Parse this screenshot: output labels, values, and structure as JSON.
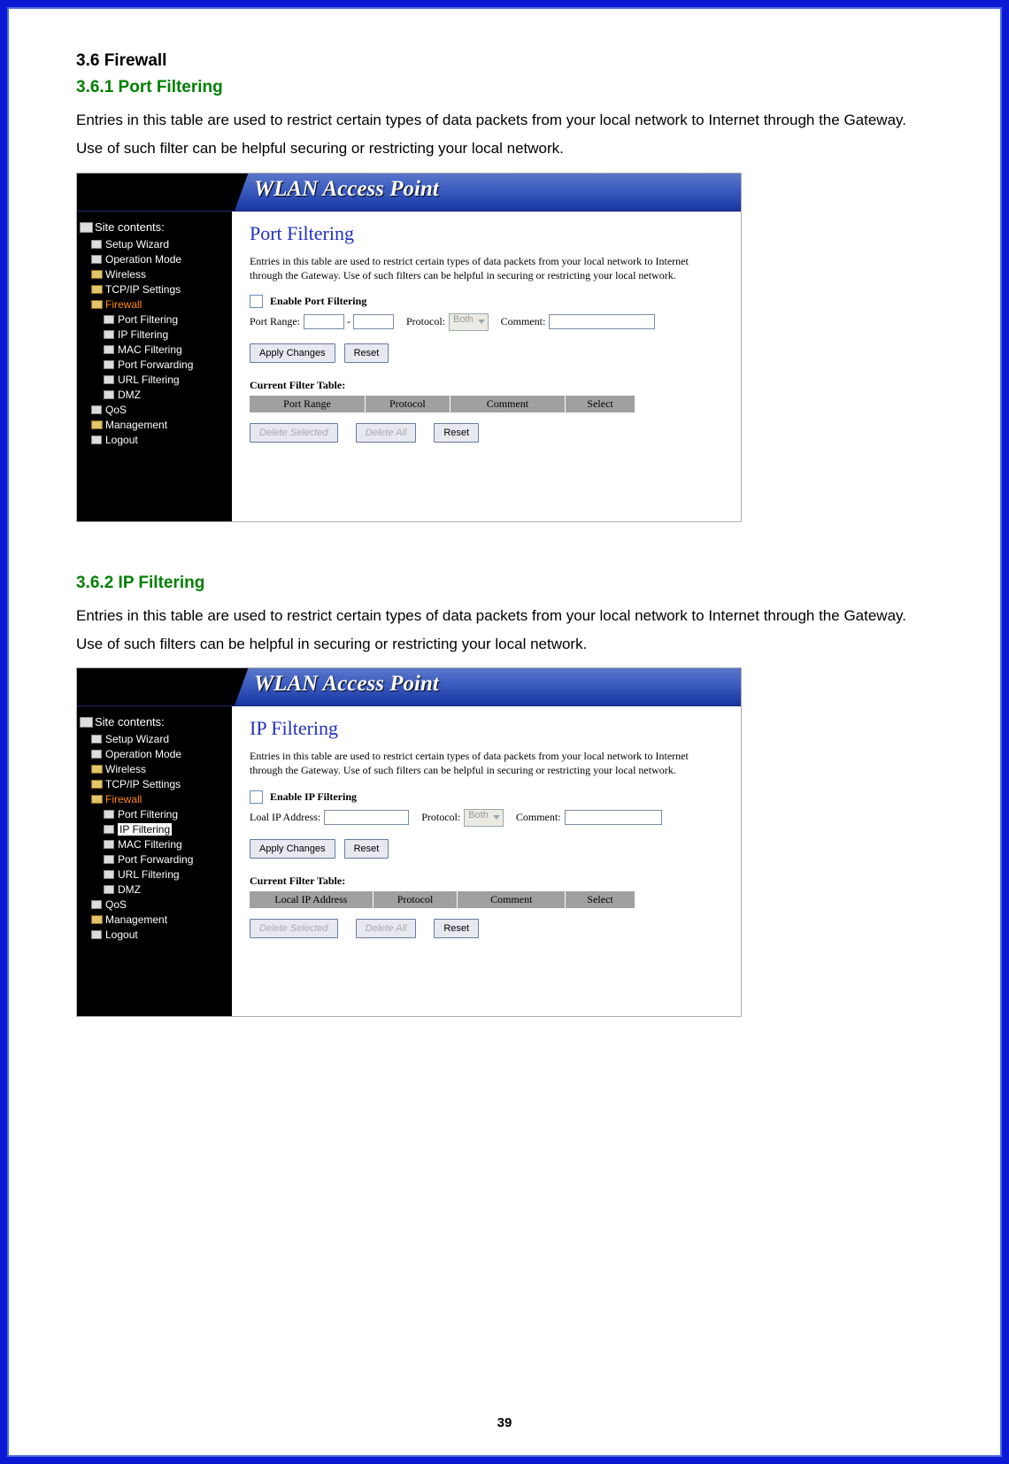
{
  "page_number": "39",
  "doc": {
    "h1": "3.6    Firewall",
    "s1_h2": "3.6.1   Port Filtering",
    "s1_p": "Entries in this table are used to restrict certain types of data packets from your local network to Internet through the Gateway. Use of such filter can be helpful securing or restricting your local network.",
    "s2_h2": "3.6.2   IP Filtering",
    "s2_p": "Entries in this table are used to restrict certain types of data packets from your local network to Internet through the Gateway. Use of such filters can be helpful in securing or restricting your local network."
  },
  "banner_title": "WLAN Access Point",
  "sidebar": {
    "header": "Site contents:",
    "setup_wizard": "Setup Wizard",
    "operation_mode": "Operation Mode",
    "wireless": "Wireless",
    "tcpip": "TCP/IP Settings",
    "firewall": "Firewall",
    "port_filtering": "Port Filtering",
    "ip_filtering": "IP Filtering",
    "mac_filtering": "MAC Filtering",
    "port_forwarding": "Port Forwarding",
    "url_filtering": "URL Filtering",
    "dmz": "DMZ",
    "qos": "QoS",
    "management": "Management",
    "logout": "Logout"
  },
  "shot1": {
    "title": "Port Filtering",
    "intro": "Entries in this table are used to restrict certain types of data packets from your local network to Internet through the Gateway. Use of such filters can be helpful in securing or restricting your local network.",
    "enable": "Enable Port Filtering",
    "port_range": "Port Range:",
    "protocol": "Protocol:",
    "protocol_val": "Both",
    "comment": "Comment:",
    "apply": "Apply Changes",
    "reset": "Reset",
    "table_caption": "Current Filter Table:",
    "th1": "Port Range",
    "th2": "Protocol",
    "th3": "Comment",
    "th4": "Select",
    "del_sel": "Delete Selected",
    "del_all": "Delete All",
    "reset2": "Reset"
  },
  "shot2": {
    "title": "IP Filtering",
    "intro": "Entries in this table are used to restrict certain types of data packets from your local network to Internet through the Gateway. Use of such filters can be helpful in securing or restricting your local network.",
    "enable": "Enable IP Filtering",
    "local_ip": "Loal IP Address:",
    "protocol": "Protocol:",
    "protocol_val": "Both",
    "comment": "Comment:",
    "apply": "Apply Changes",
    "reset": "Reset",
    "table_caption": "Current Filter Table:",
    "th1": "Local IP Address",
    "th2": "Protocol",
    "th3": "Comment",
    "th4": "Select",
    "del_sel": "Delete Selected",
    "del_all": "Delete All",
    "reset2": "Reset"
  }
}
